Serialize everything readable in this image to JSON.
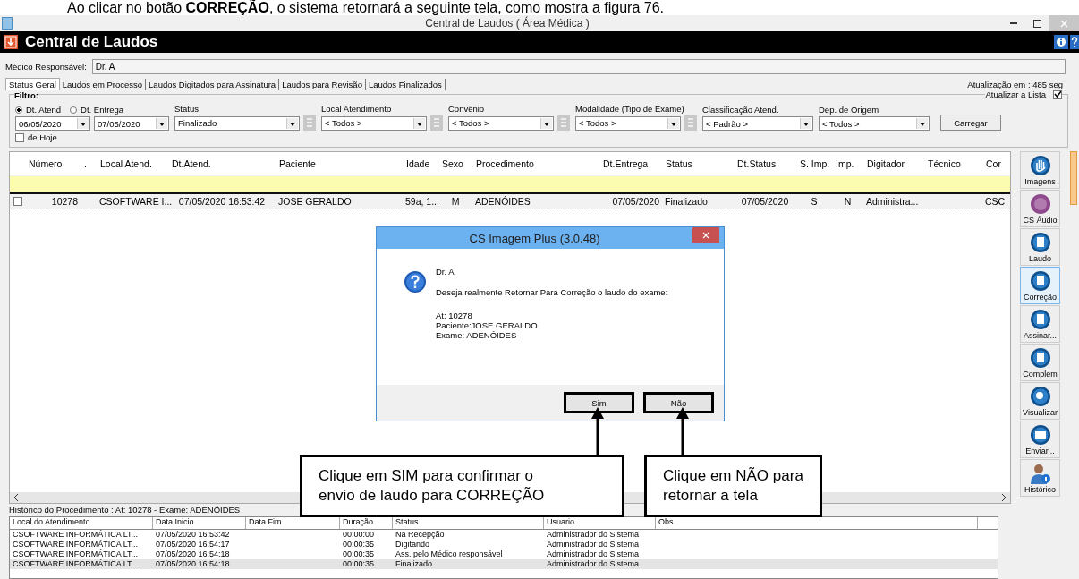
{
  "caption": "Ao clicar no botão **CORREÇÃO**, o sistema retornará a seguinte tela, como mostra a figura 76.",
  "window": {
    "title": "Central de Laudos ( Área Médica )"
  },
  "app_header": {
    "title": "Central de Laudos"
  },
  "doctor": {
    "label": "Médico Responsável:",
    "value": "Dr. A"
  },
  "tabs": [
    {
      "label": "Status Geral",
      "selected": true
    },
    {
      "label": "Laudos em Processo",
      "selected": false
    },
    {
      "label": "Laudos Digitados para Assinatura",
      "selected": false
    },
    {
      "label": "Laudos para Revisão",
      "selected": false
    },
    {
      "label": "Laudos Finalizados",
      "selected": false
    }
  ],
  "refresh_info": "Atualização em : 485 seg",
  "filter": {
    "title": "Filtro:",
    "date_modes": [
      {
        "label": "Dt. Atend",
        "selected": true
      },
      {
        "label": "Dt. Entrega",
        "selected": false
      }
    ],
    "date_from": "06/05/2020",
    "date_to": "07/05/2020",
    "today": {
      "label": "de Hoje",
      "checked": false
    },
    "dropdowns": [
      {
        "label": "Status",
        "value": "Finalizado",
        "picker": true
      },
      {
        "label": "Local Atendimento",
        "value": "< Todos >",
        "picker": true
      },
      {
        "label": "Convênio",
        "value": "< Todos >",
        "picker": true
      },
      {
        "label": "Modalidade (Tipo de Exame)",
        "value": "< Todos >",
        "picker": true
      },
      {
        "label": "Classificação Atend.",
        "value": "< Padrão >",
        "picker": false
      },
      {
        "label": "Dep. de Origem",
        "value": "< Todos >",
        "picker": false
      }
    ],
    "auto_refresh": {
      "label": "Atualizar a Lista",
      "checked": true
    },
    "load_button": "Carregar"
  },
  "grid": {
    "columns": [
      "Número",
      ".",
      "Local Atend.",
      "Dt.Atend.",
      "Paciente",
      "Idade",
      "Sexo",
      "Procedimento",
      "Dt.Entrega",
      "Status",
      "Dt.Status",
      "S. Imp.",
      "Imp.",
      "Digitador",
      "Técnico",
      "Cor"
    ],
    "rows": [
      {
        "checked": false,
        "cells": [
          "10278",
          "",
          "CSOFTWARE I...",
          "07/05/2020 16:53:42",
          "JOSE GERALDO",
          "59a, 1...",
          "M",
          "ADENÓIDES",
          "07/05/2020",
          "Finalizado",
          "07/05/2020",
          "S",
          "N",
          "Administra...",
          "",
          "CSC"
        ]
      }
    ]
  },
  "sidebar": [
    {
      "label": "Imagens",
      "selected": false
    },
    {
      "label": "CS Áudio",
      "selected": false
    },
    {
      "label": "Laudo",
      "selected": false
    },
    {
      "label": "Correção",
      "selected": true
    },
    {
      "label": "Assinar...",
      "selected": false
    },
    {
      "label": "Complem",
      "selected": false
    },
    {
      "label": "Visualizar",
      "selected": false
    },
    {
      "label": "Enviar...",
      "selected": false
    },
    {
      "label": "Histórico",
      "selected": false
    }
  ],
  "history": {
    "title": "Histórico do Procedimento : At: 10278 - Exame: ADENÓIDES",
    "columns": [
      "Local do Atendimento",
      "Data Inicio",
      "Data Fim",
      "Duração",
      "Status",
      "Usuario",
      "Obs"
    ],
    "rows": [
      {
        "selected": false,
        "cells": [
          "CSOFTWARE INFORMÁTICA LT...",
          "07/05/2020 16:53:42",
          "",
          "00:00:00",
          "Na Recepção",
          "Administrador do Sistema",
          ""
        ]
      },
      {
        "selected": false,
        "cells": [
          "CSOFTWARE INFORMÁTICA LT...",
          "07/05/2020 16:54:17",
          "",
          "00:00:35",
          "Digitando",
          "Administrador do Sistema",
          ""
        ]
      },
      {
        "selected": false,
        "cells": [
          "CSOFTWARE INFORMÁTICA LT...",
          "07/05/2020 16:54:18",
          "",
          "00:00:35",
          "Ass. pelo Médico responsável",
          "Administrador do Sistema",
          ""
        ]
      },
      {
        "selected": true,
        "cells": [
          "CSOFTWARE INFORMÁTICA LT...",
          "07/05/2020 16:54:18",
          "",
          "00:00:35",
          "Finalizado",
          "Administrador do Sistema",
          ""
        ]
      }
    ]
  },
  "dialog": {
    "title": "CS Imagem Plus (3.0.48)",
    "name": "Dr. A",
    "message": "Deseja realmente Retornar Para Correção o laudo do exame:",
    "details": [
      "At: 10278",
      "Paciente:JOSE GERALDO",
      "Exame: ADENÓIDES"
    ],
    "buttons": [
      "Sim",
      "Não"
    ]
  },
  "callouts": [
    {
      "text": "Clique em SIM para confirmar o envio de laudo para CORREÇÃO"
    },
    {
      "text": "Clique em NÃO para retornar a tela"
    }
  ]
}
